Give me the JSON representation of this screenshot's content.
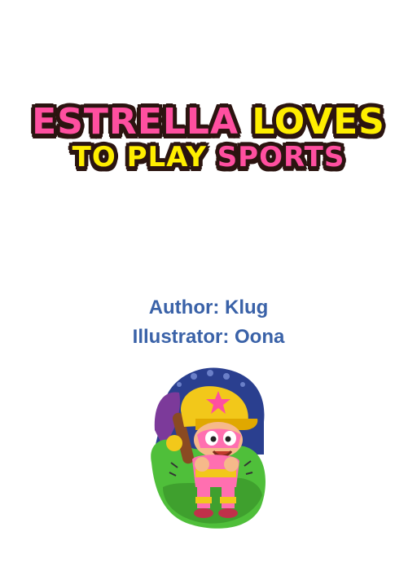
{
  "title": {
    "line1_word1": "ESTRELLA",
    "line1_word2": "LOVES",
    "line2_word1": "TO PLAY",
    "line2_word2": "SPORTS"
  },
  "credits": {
    "author": "Author: Klug",
    "illustrator": "Illustrator: Oona"
  },
  "illustration": {
    "icon": "girl-baseball-player-icon",
    "colors": {
      "sky": "#2a3f8f",
      "grass": "#4fbf3a",
      "helmet": "#f2c81a",
      "star": "#ff4fa0",
      "uniform": "#ff6fb0"
    }
  },
  "colors": {
    "title_pink": "#ff4fa0",
    "title_yellow": "#ffee00",
    "title_outline": "#2b1410",
    "credits_blue": "#3a62a8"
  }
}
